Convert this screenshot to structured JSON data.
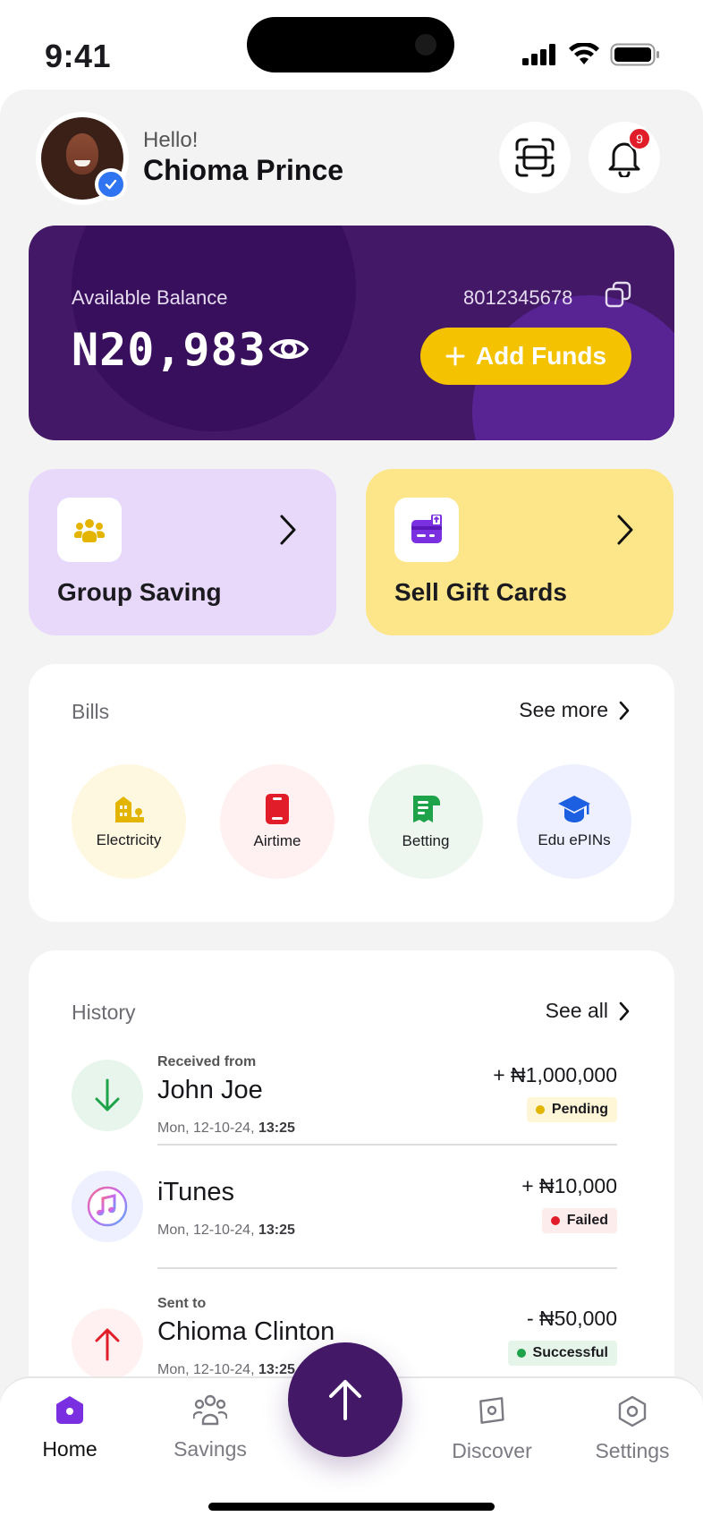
{
  "status_bar": {
    "time": "9:41"
  },
  "header": {
    "greeting": "Hello!",
    "user_name": "Chioma Prince",
    "notification_count": "9"
  },
  "balance": {
    "label": "Available Balance",
    "amount": "N20,983",
    "account_number": "8012345678",
    "add_funds_label": "Add Funds"
  },
  "quick_actions": [
    {
      "label": "Group Saving",
      "icon": "group-icon",
      "bg": "#e8d9fb"
    },
    {
      "label": "Sell Gift Cards",
      "icon": "gift-card-icon",
      "bg": "#fde68a"
    }
  ],
  "bills": {
    "title": "Bills",
    "see_more": "See more",
    "items": [
      {
        "label": "Electricity",
        "icon": "electricity-icon",
        "bg": "#fff8e1",
        "color": "#e3b400"
      },
      {
        "label": "Airtime",
        "icon": "phone-icon",
        "bg": "#fff1f1",
        "color": "#e11d2a"
      },
      {
        "label": "Betting",
        "icon": "betting-ticket-icon",
        "bg": "#edf7ef",
        "color": "#1fa34a"
      },
      {
        "label": "Edu ePINs",
        "icon": "graduation-cap-icon",
        "bg": "#eef0ff",
        "color": "#1c5fe0"
      }
    ]
  },
  "history": {
    "title": "History",
    "see_all": "See all",
    "transactions": [
      {
        "sub": "Received from",
        "name": "John Joe",
        "date": "Mon, 12-10-24,",
        "time": "13:25",
        "amount": "+ ₦1,000,000",
        "status": "Pending",
        "status_color": "#e3b400",
        "status_bg": "#fff6d8",
        "icon": "arrow-down-icon"
      },
      {
        "sub": "",
        "name": "iTunes",
        "date": "Mon, 12-10-24,",
        "time": "13:25",
        "amount": "+ ₦10,000",
        "status": "Failed",
        "status_color": "#e11d2a",
        "status_bg": "#fdecec",
        "icon": "itunes-icon"
      },
      {
        "sub": "Sent to",
        "name": "Chioma Clinton",
        "date": "Mon, 12-10-24,",
        "time": "13:25",
        "amount": "- ₦50,000",
        "status": "Successful",
        "status_color": "#1fa34a",
        "status_bg": "#e6f5ea",
        "icon": "arrow-up-icon"
      }
    ]
  },
  "nav": {
    "items": [
      {
        "label": "Home",
        "icon": "home-icon",
        "active": true
      },
      {
        "label": "Savings",
        "icon": "savings-icon",
        "active": false
      },
      {
        "label": "Discover",
        "icon": "discover-icon",
        "active": false
      },
      {
        "label": "Settings",
        "icon": "settings-icon",
        "active": false
      }
    ],
    "fab_icon": "send-arrow-up-icon"
  },
  "colors": {
    "brand_purple": "#421867",
    "accent_yellow": "#f5c200",
    "panel_bg": "#f3f3f3"
  }
}
